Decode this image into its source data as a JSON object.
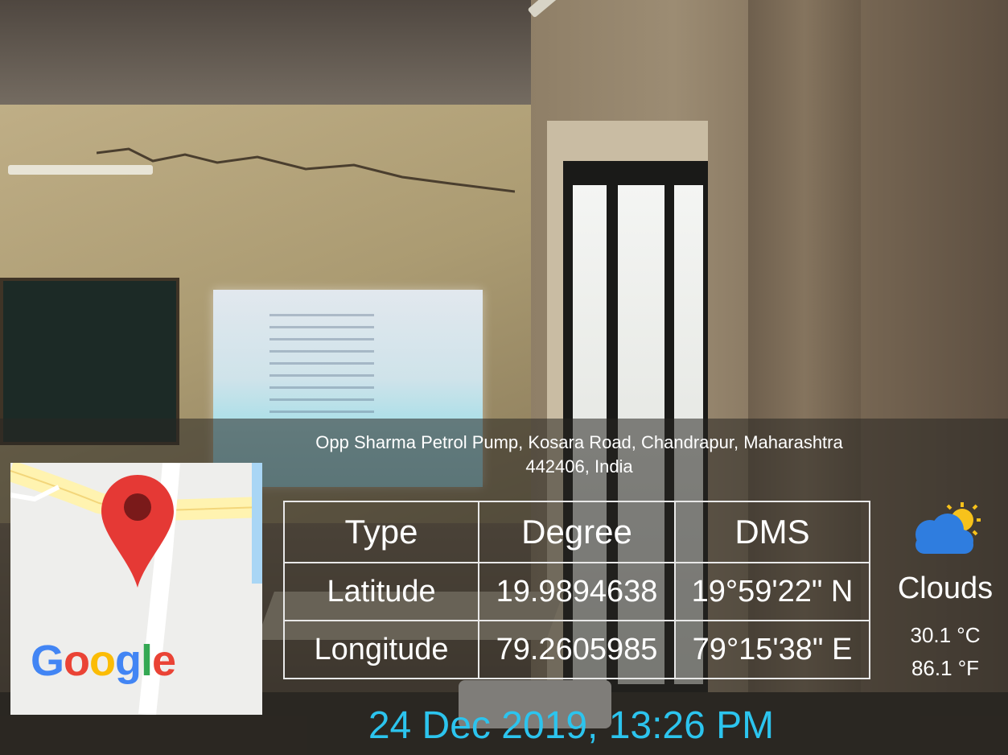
{
  "address": {
    "line1": "Opp Sharma Petrol Pump, Kosara Road, Chandrapur, Maharashtra",
    "line2": "442406, India"
  },
  "map": {
    "logo_letters": [
      "G",
      "o",
      "o",
      "g",
      "l",
      "e"
    ],
    "logo_colors": [
      "#4285F4",
      "#EA4335",
      "#FBBC05",
      "#4285F4",
      "#34A853",
      "#EA4335"
    ],
    "pin_color": "#E53935",
    "pin_icon": "map-pin-icon"
  },
  "coordinates": {
    "headers": [
      "Type",
      "Degree",
      "DMS"
    ],
    "rows": [
      {
        "type": "Latitude",
        "degree": "19.9894638",
        "dms": "19°59'22\" N"
      },
      {
        "type": "Longitude",
        "degree": "79.2605985",
        "dms": "79°15'38\" E"
      }
    ]
  },
  "weather": {
    "icon": "partly-cloudy-icon",
    "condition": "Clouds",
    "temp_c": "30.1 °C",
    "temp_f": "86.1 °F"
  },
  "datetime": "24 Dec 2019, 13:26 PM",
  "colors": {
    "datetime": "#2cc4ee",
    "cloud": "#2f7ddf",
    "sun": "#f7c21b"
  }
}
